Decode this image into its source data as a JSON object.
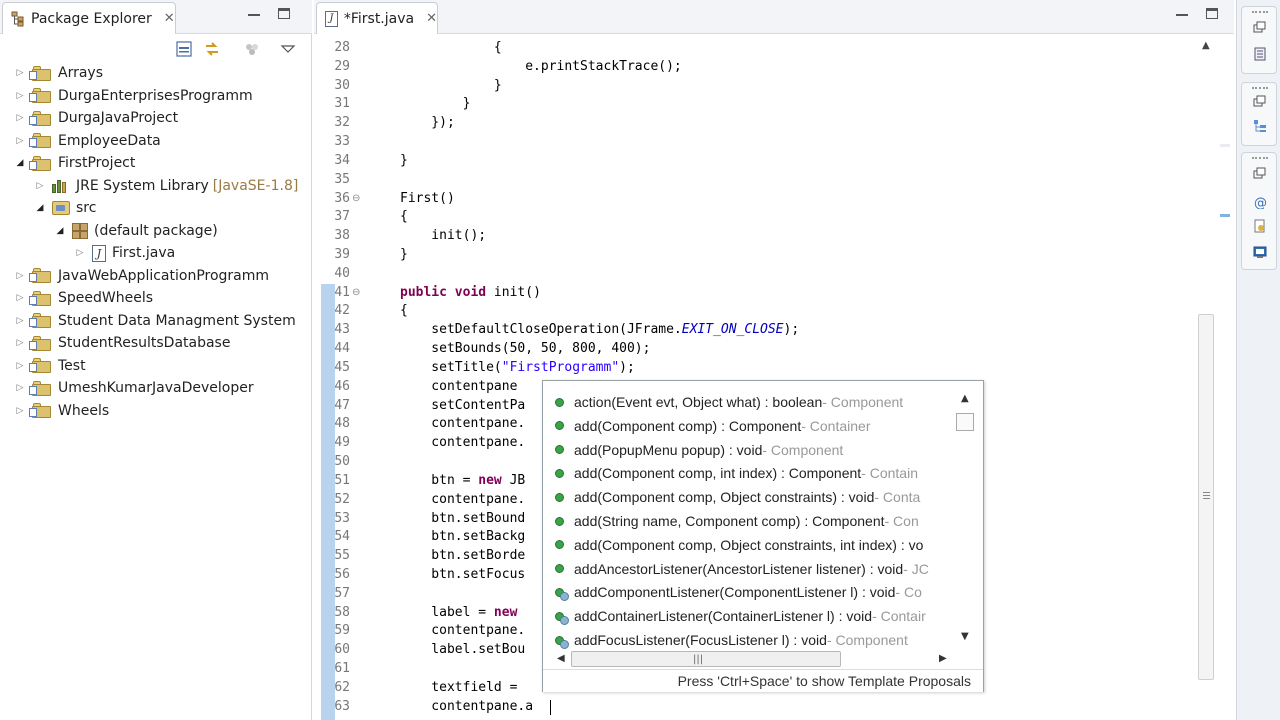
{
  "package_explorer": {
    "tab_label": "Package Explorer",
    "tree": [
      {
        "label": "Arrays",
        "depth": 0,
        "kind": "project",
        "expanded": false
      },
      {
        "label": "DurgaEnterprisesProgramm",
        "depth": 0,
        "kind": "project",
        "expanded": false
      },
      {
        "label": "DurgaJavaProject",
        "depth": 0,
        "kind": "project",
        "expanded": false
      },
      {
        "label": "EmployeeData",
        "depth": 0,
        "kind": "project",
        "expanded": false
      },
      {
        "label": "FirstProject",
        "depth": 0,
        "kind": "project",
        "expanded": true
      },
      {
        "label": "JRE System Library",
        "decoration": "[JavaSE-1.8]",
        "depth": 1,
        "kind": "library",
        "expanded": false
      },
      {
        "label": "src",
        "depth": 1,
        "kind": "source-folder",
        "expanded": true
      },
      {
        "label": "(default package)",
        "depth": 2,
        "kind": "package",
        "expanded": true
      },
      {
        "label": "First.java",
        "depth": 3,
        "kind": "java-file",
        "expanded": false
      },
      {
        "label": "JavaWebApplicationProgramm",
        "depth": 0,
        "kind": "project",
        "expanded": false
      },
      {
        "label": "SpeedWheels",
        "depth": 0,
        "kind": "project",
        "expanded": false
      },
      {
        "label": "Student Data Managment System",
        "depth": 0,
        "kind": "project",
        "expanded": false
      },
      {
        "label": "StudentResultsDatabase",
        "depth": 0,
        "kind": "project",
        "expanded": false
      },
      {
        "label": "Test",
        "depth": 0,
        "kind": "project",
        "expanded": false
      },
      {
        "label": "UmeshKumarJavaDeveloper",
        "depth": 0,
        "kind": "project",
        "expanded": false
      },
      {
        "label": "Wheels",
        "depth": 0,
        "kind": "project",
        "expanded": false
      }
    ]
  },
  "editor": {
    "tab_label": "*First.java",
    "lines": [
      {
        "n": "28",
        "html": "            {"
      },
      {
        "n": "29",
        "html": "                e.printStackTrace();"
      },
      {
        "n": "30",
        "html": "            }"
      },
      {
        "n": "31",
        "html": "        }"
      },
      {
        "n": "32",
        "html": "    });"
      },
      {
        "n": "33",
        "html": ""
      },
      {
        "n": "34",
        "html": "}"
      },
      {
        "n": "35",
        "html": ""
      },
      {
        "n": "36",
        "html": "First()",
        "fold": true
      },
      {
        "n": "37",
        "html": "{"
      },
      {
        "n": "38",
        "html": "    init();"
      },
      {
        "n": "39",
        "html": "}"
      },
      {
        "n": "40",
        "html": ""
      },
      {
        "n": "41",
        "html": "<span class=\"kw\">public</span> <span class=\"kw\">void</span> init()",
        "fold": true
      },
      {
        "n": "42",
        "html": "{"
      },
      {
        "n": "43",
        "html": "    setDefaultCloseOperation(JFrame.<span class=\"fld\">EXIT_ON_CLOSE</span>);"
      },
      {
        "n": "44",
        "html": "    setBounds(50, 50, 800, 400);"
      },
      {
        "n": "45",
        "html": "    setTitle(<span class=\"str\">\"FirstProgramm\"</span>);"
      },
      {
        "n": "46",
        "html": "    contentpane"
      },
      {
        "n": "47",
        "html": "    setContentPa"
      },
      {
        "n": "48",
        "html": "    contentpane."
      },
      {
        "n": "49",
        "html": "    contentpane."
      },
      {
        "n": "50",
        "html": ""
      },
      {
        "n": "51",
        "html": "    btn = <span class=\"kw\">new</span> JB"
      },
      {
        "n": "52",
        "html": "    contentpane."
      },
      {
        "n": "53",
        "html": "    btn.setBound"
      },
      {
        "n": "54",
        "html": "    btn.setBackg"
      },
      {
        "n": "55",
        "html": "    btn.setBorde"
      },
      {
        "n": "56",
        "html": "    btn.setFocus"
      },
      {
        "n": "57",
        "html": ""
      },
      {
        "n": "58",
        "html": "    label = <span class=\"kw\">new</span>"
      },
      {
        "n": "59",
        "html": "    contentpane."
      },
      {
        "n": "60",
        "html": "    label.setBou"
      },
      {
        "n": "61",
        "html": ""
      },
      {
        "n": "62",
        "html": "    textfield ="
      },
      {
        "n": "63",
        "html": "    contentpane.a"
      }
    ]
  },
  "content_assist": {
    "proposals": [
      {
        "sig": "action(Event evt, Object what) : boolean",
        "owner": " - Component",
        "icon": "method",
        "selected": true
      },
      {
        "sig": "add(Component comp) : Component",
        "owner": " - Container",
        "icon": "method"
      },
      {
        "sig": "add(PopupMenu popup) : void",
        "owner": " - Component",
        "icon": "method"
      },
      {
        "sig": "add(Component comp, int index) : Component",
        "owner": " - Contain",
        "icon": "method"
      },
      {
        "sig": "add(Component comp, Object constraints) : void",
        "owner": " - Conta",
        "icon": "method"
      },
      {
        "sig": "add(String name, Component comp) : Component",
        "owner": " - Con",
        "icon": "method"
      },
      {
        "sig": "add(Component comp, Object constraints, int index) : vo",
        "owner": "",
        "icon": "method"
      },
      {
        "sig": "addAncestorListener(AncestorListener listener) : void",
        "owner": " - JC",
        "icon": "method"
      },
      {
        "sig": "addComponentListener(ComponentListener l) : void",
        "owner": " - Co",
        "icon": "listener"
      },
      {
        "sig": "addContainerListener(ContainerListener l) : void",
        "owner": " - Contair",
        "icon": "listener"
      },
      {
        "sig": "addFocusListener(FocusListener l) : void",
        "owner": " - Component",
        "icon": "listener"
      }
    ],
    "hint": "Press 'Ctrl+Space' to show Template Proposals"
  },
  "colors": {
    "keyword": "#7f0055",
    "string": "#2a00ff",
    "static_field": "#0000c0",
    "method_icon": "#3aa34a"
  }
}
